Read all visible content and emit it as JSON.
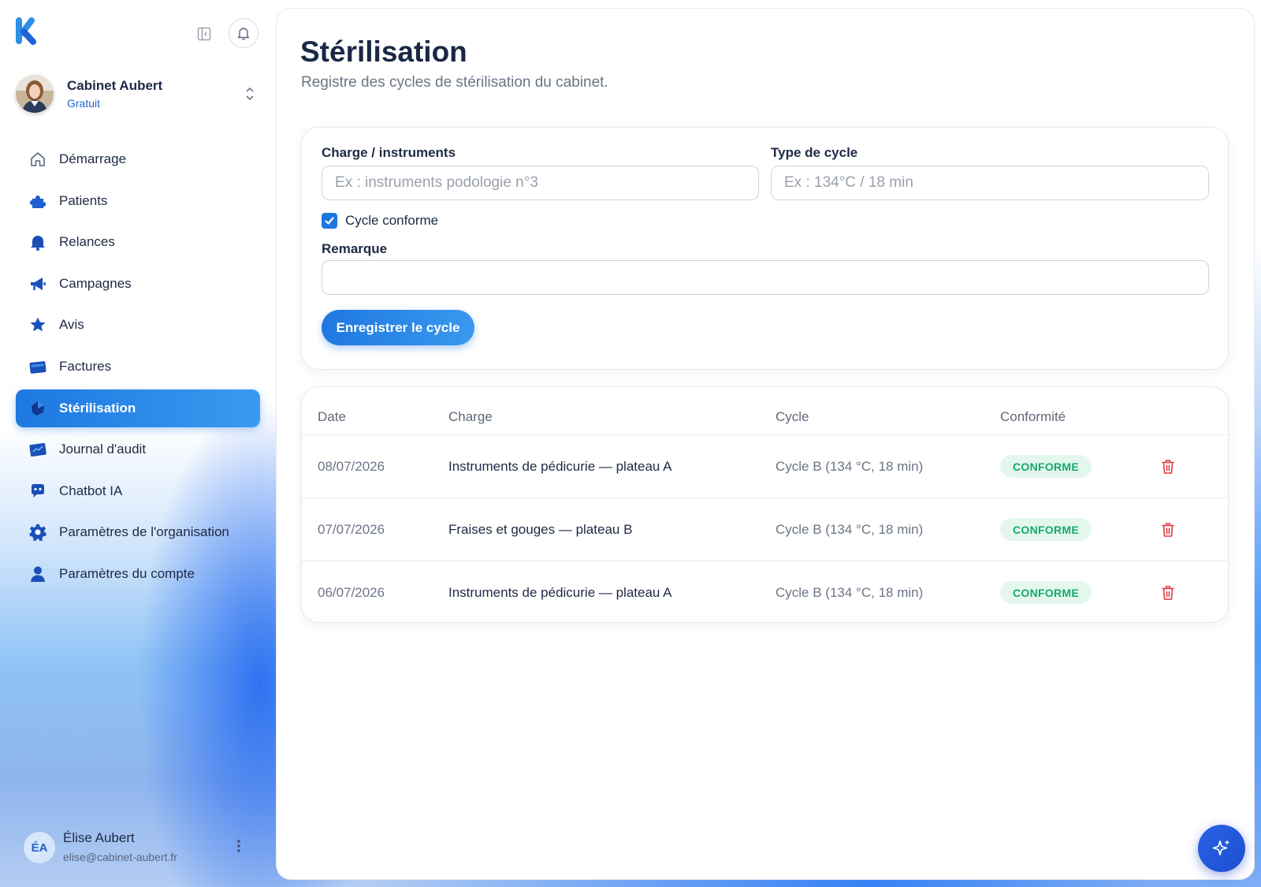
{
  "app": {
    "logo_icon": "k-logo-icon"
  },
  "org": {
    "name": "Cabinet Aubert",
    "plan": "Gratuit"
  },
  "nav": {
    "items": [
      {
        "label": "Démarrage",
        "icon": "home-icon",
        "active": false
      },
      {
        "label": "Patients",
        "icon": "puzzle-icon",
        "active": false
      },
      {
        "label": "Relances",
        "icon": "bell-icon",
        "active": false
      },
      {
        "label": "Campagnes",
        "icon": "megaphone-icon",
        "active": false
      },
      {
        "label": "Avis",
        "icon": "star-icon",
        "active": false
      },
      {
        "label": "Factures",
        "icon": "invoice-icon",
        "active": false
      },
      {
        "label": "Stérilisation",
        "icon": "sterilization-icon",
        "active": true
      },
      {
        "label": "Journal d'audit",
        "icon": "journal-icon",
        "active": false
      },
      {
        "label": "Chatbot IA",
        "icon": "chatbot-icon",
        "active": false
      },
      {
        "label": "Paramètres de l'organisation",
        "icon": "gear-icon",
        "active": false
      },
      {
        "label": "Paramètres du compte",
        "icon": "user-icon",
        "active": false
      }
    ]
  },
  "user": {
    "initials": "ÉA",
    "name": "Élise Aubert",
    "email": "elise@cabinet-aubert.fr"
  },
  "page": {
    "title": "Stérilisation",
    "subtitle": "Registre des cycles de stérilisation du cabinet."
  },
  "form": {
    "charge_label": "Charge / instruments",
    "charge_placeholder": "Ex : instruments podologie n°3",
    "charge_value": "",
    "cycle_label": "Type de cycle",
    "cycle_placeholder": "Ex : 134°C / 18 min",
    "cycle_value": "",
    "conforme_label": "Cycle conforme",
    "conforme_checked": true,
    "remarque_label": "Remarque",
    "remarque_value": "",
    "submit_label": "Enregistrer le cycle"
  },
  "table": {
    "headers": [
      "Date",
      "Charge",
      "Cycle",
      "Conformité"
    ],
    "rows": [
      {
        "date": "08/07/2026",
        "charge": "Instruments de pédicurie — plateau A",
        "cycle": "Cycle B (134 °C, 18 min)",
        "status": "CONFORME"
      },
      {
        "date": "07/07/2026",
        "charge": "Fraises et gouges — plateau B",
        "cycle": "Cycle B (134 °C, 18 min)",
        "status": "CONFORME"
      },
      {
        "date": "06/07/2026",
        "charge": "Instruments de pédicurie — plateau A",
        "cycle": "Cycle B (134 °C, 18 min)",
        "status": "CONFORME"
      }
    ]
  },
  "colors": {
    "accent": "#1e78e0",
    "success": "#17a86b",
    "danger": "#e0383e",
    "text": "#1e2a44"
  }
}
